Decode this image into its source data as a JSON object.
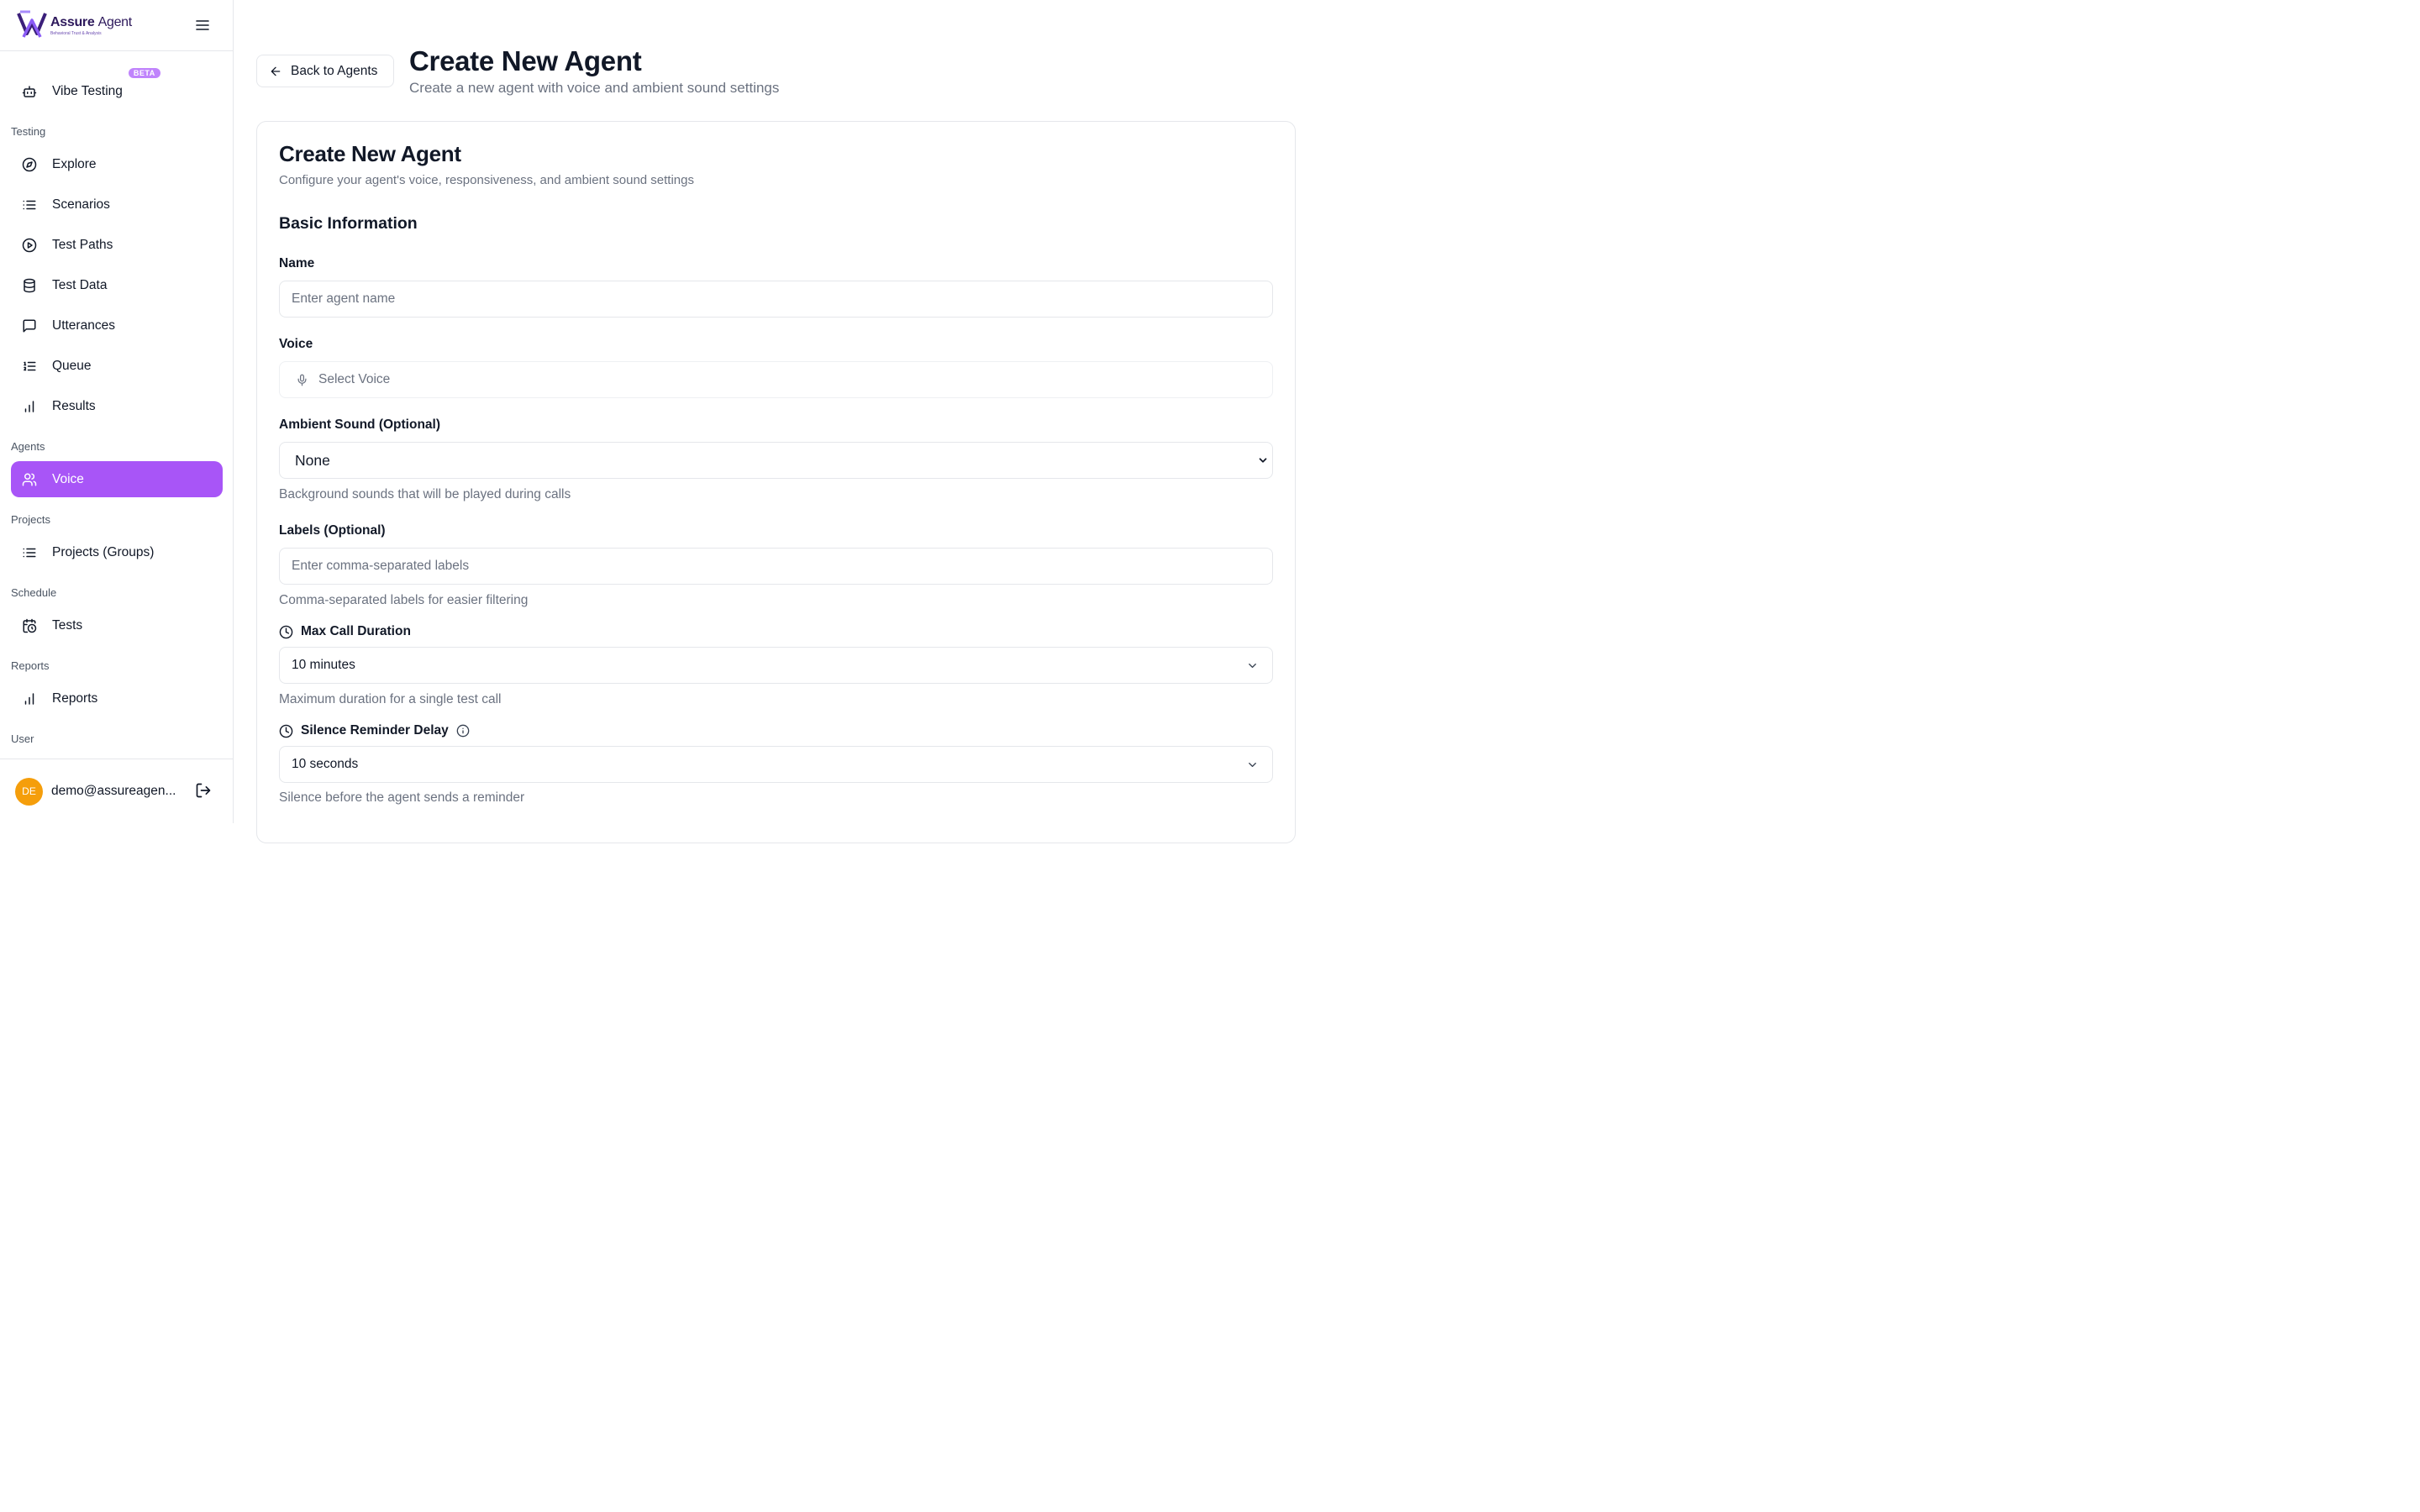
{
  "brand": {
    "name_bold": "Assure",
    "name_light": "Agent",
    "tagline": "Behavioral Trust & Analysis"
  },
  "sidebar": {
    "vibe": {
      "label": "Vibe Testing",
      "badge": "BETA"
    },
    "sections": {
      "testing": "Testing",
      "agents": "Agents",
      "projects": "Projects",
      "schedule": "Schedule",
      "reports": "Reports",
      "user": "User"
    },
    "items": {
      "explore": "Explore",
      "scenarios": "Scenarios",
      "test_paths": "Test Paths",
      "test_data": "Test Data",
      "utterances": "Utterances",
      "queue": "Queue",
      "results": "Results",
      "voice": "Voice",
      "projects_groups": "Projects (Groups)",
      "tests": "Tests",
      "reports": "Reports"
    },
    "user": {
      "initials": "DE",
      "email": "demo@assureagen..."
    }
  },
  "header": {
    "back_label": "Back to Agents",
    "title": "Create New Agent",
    "subtitle": "Create a new agent with voice and ambient sound settings"
  },
  "form": {
    "title": "Create New Agent",
    "description": "Configure your agent's voice, responsiveness, and ambient sound settings",
    "section_basic": "Basic Information",
    "name": {
      "label": "Name",
      "placeholder": "Enter agent name"
    },
    "voice": {
      "label": "Voice",
      "placeholder": "Select Voice"
    },
    "ambient": {
      "label": "Ambient Sound (Optional)",
      "value": "None",
      "help": "Background sounds that will be played during calls"
    },
    "labels": {
      "label": "Labels (Optional)",
      "placeholder": "Enter comma-separated labels",
      "help": "Comma-separated labels for easier filtering"
    },
    "max_duration": {
      "label": "Max Call Duration",
      "value": "10 minutes",
      "help": "Maximum duration for a single test call"
    },
    "silence_delay": {
      "label": "Silence Reminder Delay",
      "value": "10 seconds",
      "help": "Silence before the agent sends a reminder"
    }
  },
  "colors": {
    "accent": "#a855f7",
    "badge": "#c084fc",
    "avatar": "#f59e0b",
    "brand_dark": "#2e1a5c"
  },
  "icons": {
    "vibe": "robot-icon",
    "explore": "compass-icon",
    "scenarios": "list-icon",
    "test_paths": "play-circle-icon",
    "test_data": "database-icon",
    "utterances": "message-square-icon",
    "queue": "list-ordered-icon",
    "results": "bar-chart-icon",
    "voice": "users-icon",
    "projects": "list-icon",
    "tests": "calendar-clock-icon",
    "reports": "bar-chart-icon",
    "logout": "log-out-icon",
    "clock": "clock-icon",
    "info": "info-icon",
    "mic": "mic-icon"
  }
}
